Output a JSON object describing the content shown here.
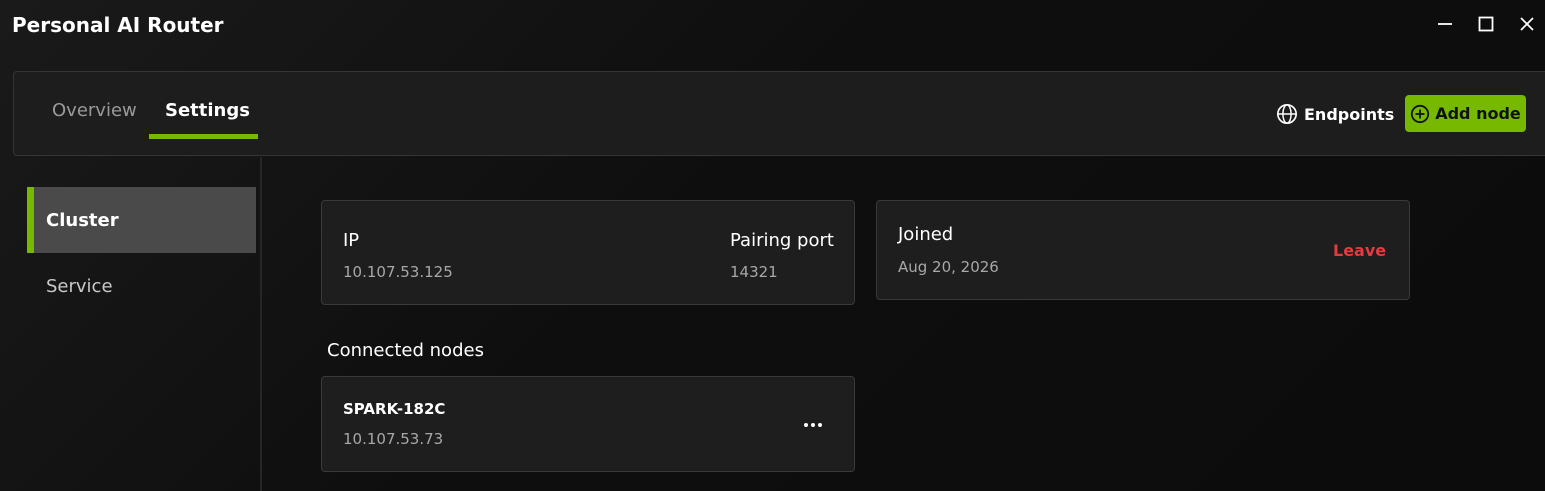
{
  "window": {
    "title": "Personal AI Router",
    "controls": [
      "minimize-icon",
      "maximize-icon",
      "close-icon"
    ]
  },
  "header": {
    "tabs": [
      {
        "label": "Overview",
        "active": false
      },
      {
        "label": "Settings",
        "active": true
      }
    ],
    "endpoints_label": "Endpoints",
    "endpoints_icon": "globe-icon",
    "add_node_label": "Add node",
    "add_node_icon": "plus-circle-icon"
  },
  "sidebar": {
    "items": [
      {
        "label": "Cluster",
        "active": true
      },
      {
        "label": "Service",
        "active": false
      }
    ]
  },
  "cluster": {
    "ip_label": "IP",
    "ip_value": "10.107.53.125",
    "port_label": "Pairing port",
    "port_value": "14321",
    "joined_label": "Joined",
    "joined_value": "Aug 20, 2026",
    "leave_label": "Leave",
    "connected_title": "Connected nodes",
    "nodes": [
      {
        "name": "SPARK-182C",
        "ip": "10.107.53.73"
      }
    ]
  },
  "colors": {
    "accent": "#76b900",
    "danger": "#e5393f",
    "background": "#111111",
    "card": "#1e1e1e"
  }
}
